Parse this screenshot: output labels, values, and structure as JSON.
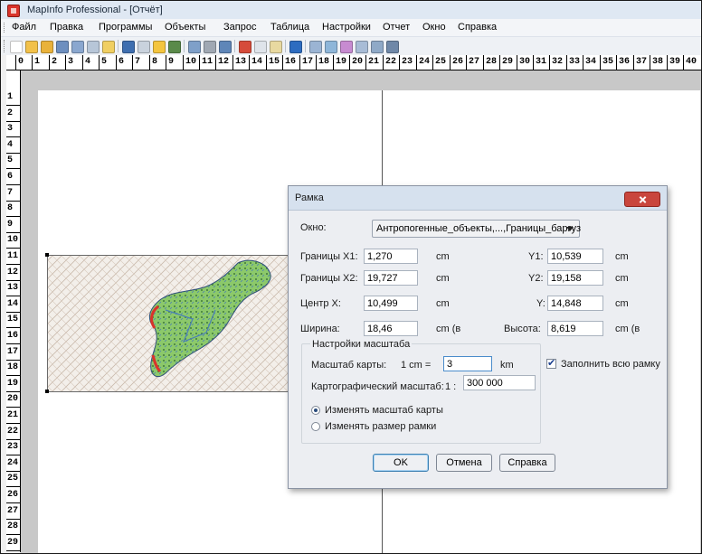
{
  "window": {
    "title": "MapInfo Professional - [Отчёт]"
  },
  "menu": [
    "Файл",
    "Правка",
    "Программы",
    "Объекты",
    "Запрос",
    "Таблица",
    "Настройки",
    "Отчет",
    "Окно",
    "Справка"
  ],
  "toolbar": {
    "icons": [
      "new-icon",
      "open-icon",
      "open-folder-icon",
      "save-icon",
      "save-copy-icon",
      "print-setup-icon",
      "workspace-icon",
      "save-disk-icon",
      "print-icon",
      "open-table-icon",
      "export-icon",
      "copy-window-icon",
      "print-window-icon",
      "print-preview-icon",
      "cut-icon",
      "copy-icon",
      "paste-icon",
      "undo-icon",
      "mapper-icon",
      "browser-icon",
      "graph-icon",
      "layout-icon",
      "legend-icon",
      "statistics-icon"
    ]
  },
  "ruler": {
    "horizontal": [
      "0",
      "1",
      "2",
      "3",
      "4",
      "5",
      "6",
      "7",
      "8",
      "9",
      "10",
      "11",
      "12",
      "13",
      "14",
      "15",
      "16",
      "17",
      "18",
      "19",
      "20",
      "21",
      "22",
      "23",
      "24",
      "25",
      "26",
      "27",
      "28",
      "29",
      "30",
      "31",
      "32",
      "33",
      "34",
      "35",
      "36",
      "37",
      "38",
      "39",
      "40"
    ],
    "vertical": [
      "1",
      "2",
      "3",
      "4",
      "5",
      "6",
      "7",
      "8",
      "9",
      "10",
      "11",
      "12",
      "13",
      "14",
      "15",
      "16",
      "17",
      "18",
      "19",
      "20",
      "21",
      "22",
      "23",
      "24",
      "25",
      "26",
      "27",
      "28",
      "29"
    ]
  },
  "dialog": {
    "title": "Рамка",
    "window_label": "Окно:",
    "window_value": "Антропогенные_объекты,...,Границы_баргуз",
    "x1_label": "Границы X1:",
    "x1_value": "1,270",
    "x1_unit": "cm",
    "x2_label": "Границы X2:",
    "x2_value": "19,727",
    "x2_unit": "cm",
    "cx_label": "Центр X:",
    "cx_value": "10,499",
    "cx_unit": "cm",
    "y1_label": "Y1:",
    "y1_value": "10,539",
    "y1_unit": "cm",
    "y2_label": "Y2:",
    "y2_value": "19,158",
    "y2_unit": "cm",
    "cy_label": "Y:",
    "cy_value": "14,848",
    "cy_unit": "cm",
    "width_label": "Ширина:",
    "width_value": "18,46",
    "width_unit": "cm (в",
    "height_label": "Высота:",
    "height_value": "8,619",
    "height_unit": "cm (в",
    "scale_group_title": "Настройки масштаба",
    "map_scale_label": "Масштаб карты:",
    "map_scale_cm": "1 cm =",
    "map_scale_value": "3",
    "map_scale_unit": "km",
    "carto_scale_label": "Картографический масштаб:",
    "carto_scale_prefix": "1 :",
    "carto_scale_value": "300 000",
    "radio_change_scale": "Изменять масштаб карты",
    "radio_change_frame": "Изменять размер рамки",
    "fill_frame_label": "Заполнить всю рамку",
    "ok_label": "OK",
    "cancel_label": "Отмена",
    "help_label": "Справка"
  },
  "colors": {
    "map_green": "#8cc96a",
    "map_blue": "#4a7fb5",
    "map_red": "#d9342b",
    "close_red": "#c9463d"
  }
}
